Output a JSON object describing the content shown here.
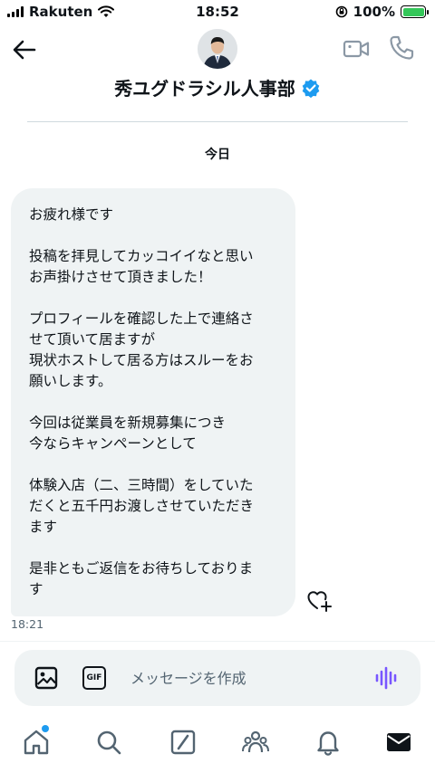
{
  "status_bar": {
    "carrier": "Rakuten",
    "time": "18:52",
    "battery": "100%",
    "battery_color": "#34c759",
    "icons": [
      "signal-icon",
      "wifi-icon",
      "rotation-lock-icon",
      "battery-charging-icon"
    ]
  },
  "header": {
    "title": "秀ユグドラシル人事部",
    "verified_color": "#1d9bf0",
    "icons": [
      "back-arrow-icon",
      "avatar",
      "verified-badge-icon",
      "video-call-icon",
      "phone-call-icon"
    ]
  },
  "conversation": {
    "date_label": "今日",
    "message": {
      "lines": [
        "お疲れ様です",
        "",
        "投稿を拝見してカッコイイなと思い",
        "お声掛けさせて頂きました！",
        "",
        "プロフィールを確認した上で連絡さ",
        "せて頂いて居ますが",
        "現状ホストして居る方はスルーをお",
        "願いします。",
        "",
        "今回は従業員を新規募集につき",
        "今ならキャンペーンとして",
        "",
        "体験入店（二、三時間）をしていた",
        "だくと五千円お渡しさせていただき",
        "ます",
        "",
        "是非ともご返信をお待ちしておりま",
        "す"
      ],
      "time": "18:21",
      "bubble_color": "#eff3f4"
    }
  },
  "composer": {
    "placeholder": "メッセージを作成",
    "gif_label": "GIF",
    "voice_color": "#7856ff"
  },
  "tabbar": {
    "items": [
      "home-icon",
      "search-icon",
      "grok-icon",
      "communities-icon",
      "notifications-icon",
      "messages-icon"
    ],
    "dot_color": "#1d9bf0"
  }
}
